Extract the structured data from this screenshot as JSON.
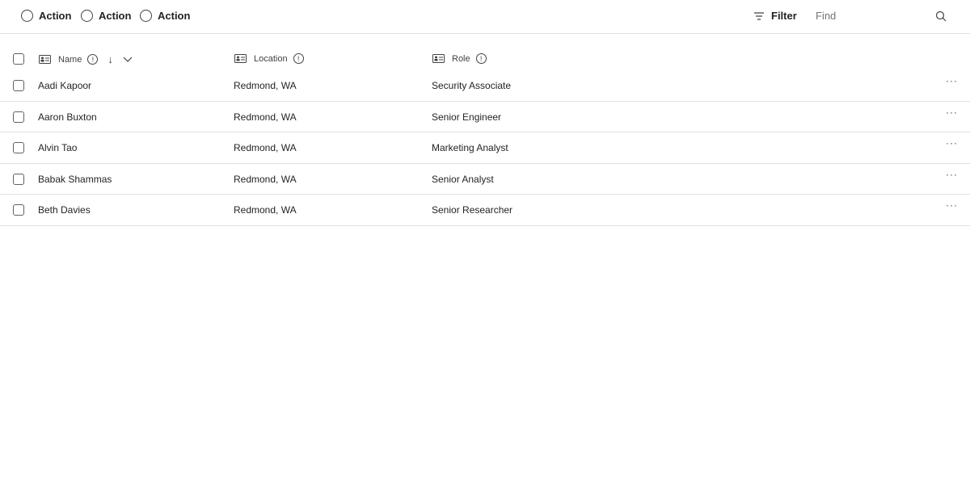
{
  "toolbar": {
    "actions": [
      "Action",
      "Action",
      "Action"
    ],
    "filter_label": "Filter",
    "find_placeholder": "Find"
  },
  "columns": {
    "name": "Name",
    "location": "Location",
    "role": "Role"
  },
  "rows": [
    {
      "name": "Aadi Kapoor",
      "location": "Redmond, WA",
      "role": "Security Associate"
    },
    {
      "name": "Aaron Buxton",
      "location": "Redmond, WA",
      "role": "Senior Engineer"
    },
    {
      "name": "Alvin Tao",
      "location": "Redmond, WA",
      "role": "Marketing Analyst"
    },
    {
      "name": "Babak Shammas",
      "location": "Redmond, WA",
      "role": "Senior Analyst"
    },
    {
      "name": "Beth Davies",
      "location": "Redmond, WA",
      "role": "Senior Researcher"
    }
  ],
  "more_label": "···"
}
